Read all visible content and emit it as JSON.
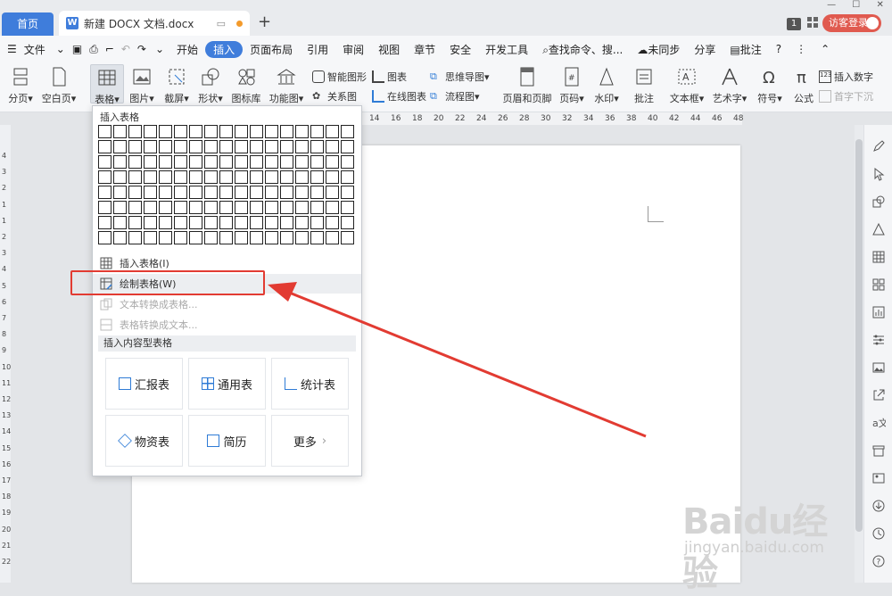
{
  "tabs": {
    "home": "首页",
    "doc": "新建 DOCX 文档.docx",
    "new": "+"
  },
  "title_right": {
    "page_count": "1",
    "login": "访客登录"
  },
  "menu": {
    "file": "文件",
    "items": [
      "开始",
      "插入",
      "页面布局",
      "引用",
      "审阅",
      "视图",
      "章节",
      "安全",
      "开发工具"
    ],
    "active": "插入",
    "search": "查找命令、搜...",
    "sync": "未同步",
    "share": "分享",
    "comment": "批注"
  },
  "ribbon": {
    "page_break": "分页",
    "blank_page": "空白页",
    "table": "表格",
    "picture": "图片",
    "screenshot": "截屏",
    "shape": "形状",
    "icon_lib": "图标库",
    "func_chart": "功能图",
    "smart_graphic": "智能图形",
    "chart": "图表",
    "mind_map": "思维导图",
    "relation": "关系图",
    "online_chart": "在线图表",
    "flowchart": "流程图",
    "header_footer": "页眉和页脚",
    "page_num": "页码",
    "watermark": "水印",
    "annotation": "批注",
    "textbox": "文本框",
    "wordart": "艺术字",
    "symbol": "符号",
    "formula": "公式",
    "insert_number": "插入数字",
    "drop_cap": "首字下沉"
  },
  "ruler_top": [
    "14",
    "16",
    "18",
    "20",
    "22",
    "24",
    "26",
    "28",
    "30",
    "32",
    "34",
    "36",
    "38",
    "40",
    "42",
    "44",
    "46",
    "48"
  ],
  "ruler_left": [
    "4",
    "3",
    "2",
    "1",
    "1",
    "2",
    "3",
    "4",
    "5",
    "6",
    "7",
    "8",
    "9",
    "10",
    "11",
    "12",
    "13",
    "14",
    "15",
    "16",
    "17",
    "18",
    "19",
    "20",
    "21",
    "22"
  ],
  "dropdown": {
    "title": "插入表格",
    "insert_table": "插入表格(I)",
    "draw_table": "绘制表格(W)",
    "text_to_table": "文本转换成表格...",
    "table_to_text": "表格转换成文本...",
    "content_section": "插入内容型表格",
    "cards": [
      "汇报表",
      "通用表",
      "统计表",
      "物资表",
      "简历",
      "更多"
    ]
  },
  "watermark": {
    "brand": "Baidu经验",
    "url": "jingyan.baidu.com"
  },
  "colors": {
    "accent": "#3f7ddb",
    "annotation_red": "#e23b32",
    "login_red": "#e05a4f"
  }
}
